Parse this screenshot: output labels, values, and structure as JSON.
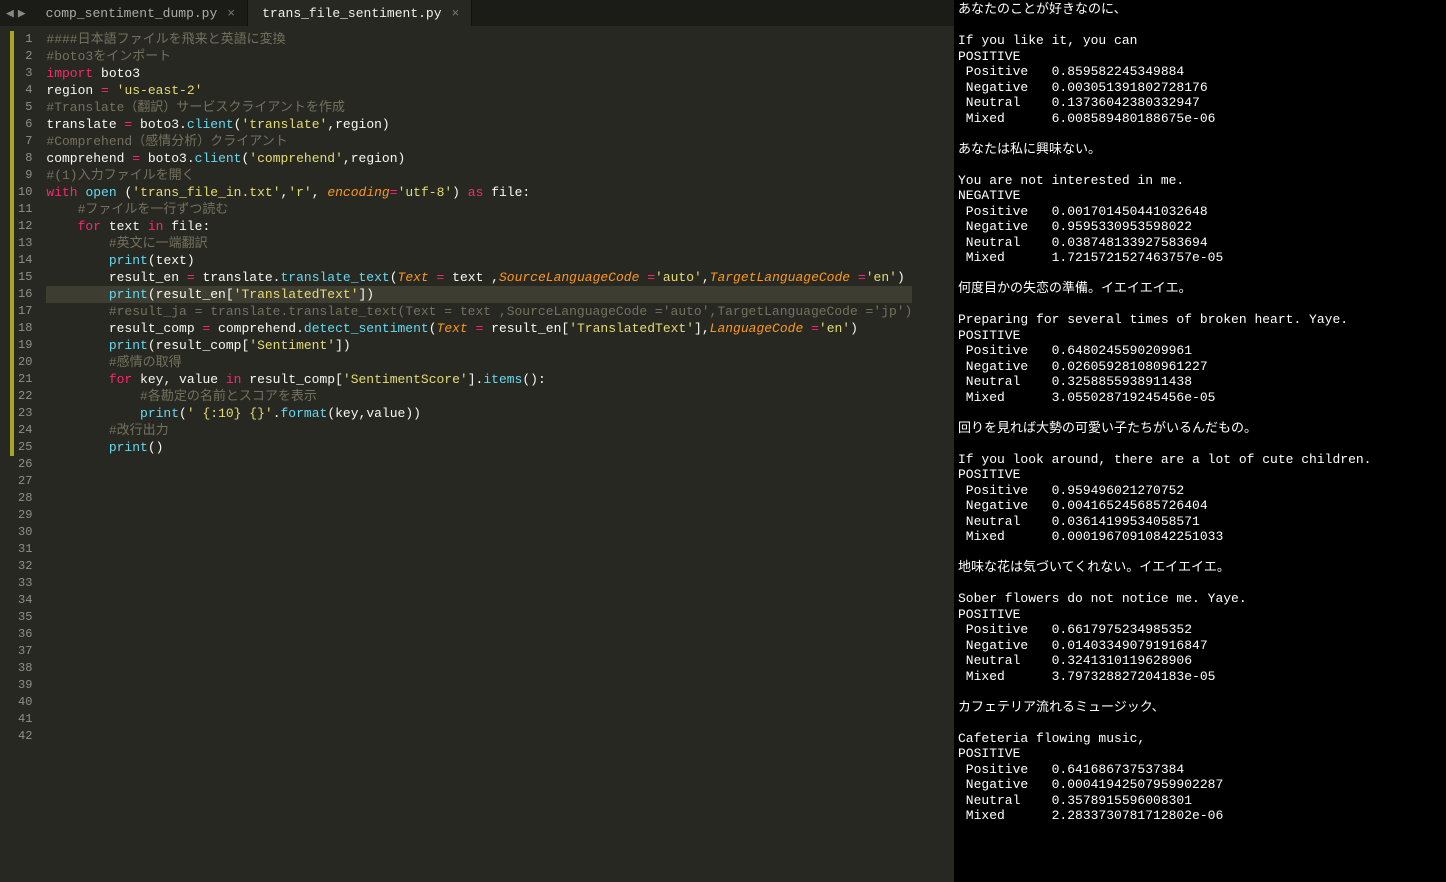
{
  "tabs": [
    {
      "label": "comp_sentiment_dump.py",
      "active": false
    },
    {
      "label": "trans_file_sentiment.py",
      "active": true
    }
  ],
  "gutter_last_line": 42,
  "modified_lines": [
    1,
    2,
    3,
    4,
    5,
    6,
    7,
    8,
    9,
    10,
    11,
    12,
    13,
    14,
    15,
    16,
    17,
    18,
    19,
    20,
    21,
    22,
    23,
    24,
    25
  ],
  "current_line": 16,
  "tokens": {
    "1": [
      [
        "cm",
        "####日本語ファイルを飛来と英語に変換"
      ]
    ],
    "2": [
      [
        "cm",
        "#boto3をインポート"
      ]
    ],
    "3": [
      [
        "kw",
        "import"
      ],
      [
        "def",
        " boto3"
      ]
    ],
    "4": [
      [
        "def",
        "region "
      ],
      [
        "op",
        "="
      ],
      [
        "def",
        " "
      ],
      [
        "st",
        "'us-east-2'"
      ]
    ],
    "5": [
      [
        "cm",
        "#Translate（翻訳）サービスクライアントを作成"
      ]
    ],
    "6": [
      [
        "def",
        "translate "
      ],
      [
        "op",
        "="
      ],
      [
        "def",
        " boto3"
      ],
      [
        "def",
        "."
      ],
      [
        "fn",
        "client"
      ],
      [
        "def",
        "("
      ],
      [
        "st",
        "'translate'"
      ],
      [
        "def",
        ",region)"
      ]
    ],
    "7": [
      [
        "cm",
        "#Comprehend（感情分析）クライアント"
      ]
    ],
    "8": [
      [
        "def",
        "comprehend "
      ],
      [
        "op",
        "="
      ],
      [
        "def",
        " boto3"
      ],
      [
        "def",
        "."
      ],
      [
        "fn",
        "client"
      ],
      [
        "def",
        "("
      ],
      [
        "st",
        "'comprehend'"
      ],
      [
        "def",
        ",region)"
      ]
    ],
    "9": [
      [
        "cm",
        "#(1)入力ファイルを開く"
      ]
    ],
    "10": [
      [
        "kw",
        "with"
      ],
      [
        "def",
        " "
      ],
      [
        "fn",
        "open"
      ],
      [
        "def",
        " ("
      ],
      [
        "st",
        "'trans_file_in.txt'"
      ],
      [
        "def",
        ","
      ],
      [
        "st",
        "'r'"
      ],
      [
        "def",
        ", "
      ],
      [
        "pa",
        "encoding"
      ],
      [
        "op",
        "="
      ],
      [
        "st",
        "'utf-8'"
      ],
      [
        "def",
        ") "
      ],
      [
        "kw",
        "as"
      ],
      [
        "def",
        " file:"
      ]
    ],
    "11": [
      [
        "def",
        "    "
      ],
      [
        "cm",
        "#ファイルを一行ずつ読む"
      ]
    ],
    "12": [
      [
        "def",
        "    "
      ],
      [
        "kw",
        "for"
      ],
      [
        "def",
        " text "
      ],
      [
        "kw",
        "in"
      ],
      [
        "def",
        " file:"
      ]
    ],
    "13": [
      [
        "def",
        "        "
      ],
      [
        "cm",
        "#英文に一端翻訳"
      ]
    ],
    "14": [
      [
        "def",
        "        "
      ],
      [
        "fn",
        "print"
      ],
      [
        "def",
        "(text)"
      ]
    ],
    "15": [
      [
        "def",
        "        result_en "
      ],
      [
        "op",
        "="
      ],
      [
        "def",
        " translate"
      ],
      [
        "def",
        "."
      ],
      [
        "fn",
        "translate_text"
      ],
      [
        "def",
        "("
      ],
      [
        "pa",
        "Text"
      ],
      [
        "def",
        " "
      ],
      [
        "op",
        "="
      ],
      [
        "def",
        " text ,"
      ],
      [
        "pa",
        "SourceLanguageCode"
      ],
      [
        "def",
        " "
      ],
      [
        "op",
        "="
      ],
      [
        "st",
        "'auto'"
      ],
      [
        "def",
        ","
      ],
      [
        "pa",
        "TargetLanguageCode"
      ],
      [
        "def",
        " "
      ],
      [
        "op",
        "="
      ],
      [
        "st",
        "'en'"
      ],
      [
        "def",
        ")"
      ]
    ],
    "16": [
      [
        "def",
        "        "
      ],
      [
        "fn",
        "print"
      ],
      [
        "def",
        "(result_en["
      ],
      [
        "st",
        "'TranslatedText'"
      ],
      [
        "def",
        "])"
      ]
    ],
    "17": [
      [
        "def",
        "        "
      ],
      [
        "cm",
        "#result_ja = translate.translate_text(Text = text ,SourceLanguageCode ='auto',TargetLanguageCode ='jp')"
      ]
    ],
    "18": [
      [
        "def",
        "        result_comp "
      ],
      [
        "op",
        "="
      ],
      [
        "def",
        " comprehend"
      ],
      [
        "def",
        "."
      ],
      [
        "fn",
        "detect_sentiment"
      ],
      [
        "def",
        "("
      ],
      [
        "pa",
        "Text"
      ],
      [
        "def",
        " "
      ],
      [
        "op",
        "="
      ],
      [
        "def",
        " result_en["
      ],
      [
        "st",
        "'TranslatedText'"
      ],
      [
        "def",
        "],"
      ],
      [
        "pa",
        "LanguageCode"
      ],
      [
        "def",
        " "
      ],
      [
        "op",
        "="
      ],
      [
        "st",
        "'en'"
      ],
      [
        "def",
        ")"
      ]
    ],
    "19": [
      [
        "def",
        "        "
      ],
      [
        "fn",
        "print"
      ],
      [
        "def",
        "(result_comp["
      ],
      [
        "st",
        "'Sentiment'"
      ],
      [
        "def",
        "])"
      ]
    ],
    "20": [
      [
        "def",
        "        "
      ],
      [
        "cm",
        "#感情の取得"
      ]
    ],
    "21": [
      [
        "def",
        "        "
      ],
      [
        "kw",
        "for"
      ],
      [
        "def",
        " key, value "
      ],
      [
        "kw",
        "in"
      ],
      [
        "def",
        " result_comp["
      ],
      [
        "st",
        "'SentimentScore'"
      ],
      [
        "def",
        "]"
      ],
      [
        "def",
        "."
      ],
      [
        "fn",
        "items"
      ],
      [
        "def",
        "():"
      ]
    ],
    "22": [
      [
        "def",
        "            "
      ],
      [
        "cm",
        "#各勘定の名前とスコアを表示"
      ]
    ],
    "23": [
      [
        "def",
        "            "
      ],
      [
        "fn",
        "print"
      ],
      [
        "def",
        "("
      ],
      [
        "st",
        "' {:10} {}'"
      ],
      [
        "def",
        "."
      ],
      [
        "fn",
        "format"
      ],
      [
        "def",
        "(key,value))"
      ]
    ],
    "24": [
      [
        "def",
        "        "
      ],
      [
        "cm",
        "#改行出力"
      ]
    ],
    "25": [
      [
        "def",
        "        "
      ],
      [
        "fn",
        "print"
      ],
      [
        "def",
        "()"
      ]
    ]
  },
  "terminal": {
    "blocks": [
      {
        "jp": "あなたのことが好きなのに、",
        "en": "If you like it, you can",
        "sent": "POSITIVE",
        "scores": {
          "Positive": "0.859582245349884",
          "Negative": "0.003051391802728176",
          "Neutral": "0.13736042380332947",
          "Mixed": "6.008589480188675e-06"
        }
      },
      {
        "jp": "あなたは私に興味ない。",
        "en": "You are not interested in me.",
        "sent": "NEGATIVE",
        "scores": {
          "Positive": "0.001701450441032648",
          "Negative": "0.9595330953598022",
          "Neutral": "0.038748133927583694",
          "Mixed": "1.7215721527463757e-05"
        }
      },
      {
        "jp": "何度目かの失恋の準備。イエイエイエ。",
        "en": "Preparing for several times of broken heart. Yaye.",
        "sent": "POSITIVE",
        "scores": {
          "Positive": "0.6480245590209961",
          "Negative": "0.026059281080961227",
          "Neutral": "0.3258855938911438",
          "Mixed": "3.055028719245456e-05"
        }
      },
      {
        "jp": "回りを見れば大勢の可愛い子たちがいるんだもの。",
        "en": "If you look around, there are a lot of cute children.",
        "sent": "POSITIVE",
        "scores": {
          "Positive": "0.959496021270752",
          "Negative": "0.004165245685726404",
          "Neutral": "0.03614199534058571",
          "Mixed": "0.00019670910842251033"
        }
      },
      {
        "jp": "地味な花は気づいてくれない。イエイエイエ。",
        "en": "Sober flowers do not notice me. Yaye.",
        "sent": "POSITIVE",
        "scores": {
          "Positive": "0.6617975234985352",
          "Negative": "0.014033490791916847",
          "Neutral": "0.3241310119628906",
          "Mixed": "3.797328827204183e-05"
        }
      },
      {
        "jp": "カフェテリア流れるミュージック、",
        "en": "Cafeteria flowing music,",
        "sent": "POSITIVE",
        "scores": {
          "Positive": "0.641686737537384",
          "Negative": "0.00041942507959902287",
          "Neutral": "0.3578915596008301",
          "Mixed": "2.2833730781712802e-06"
        }
      }
    ]
  }
}
